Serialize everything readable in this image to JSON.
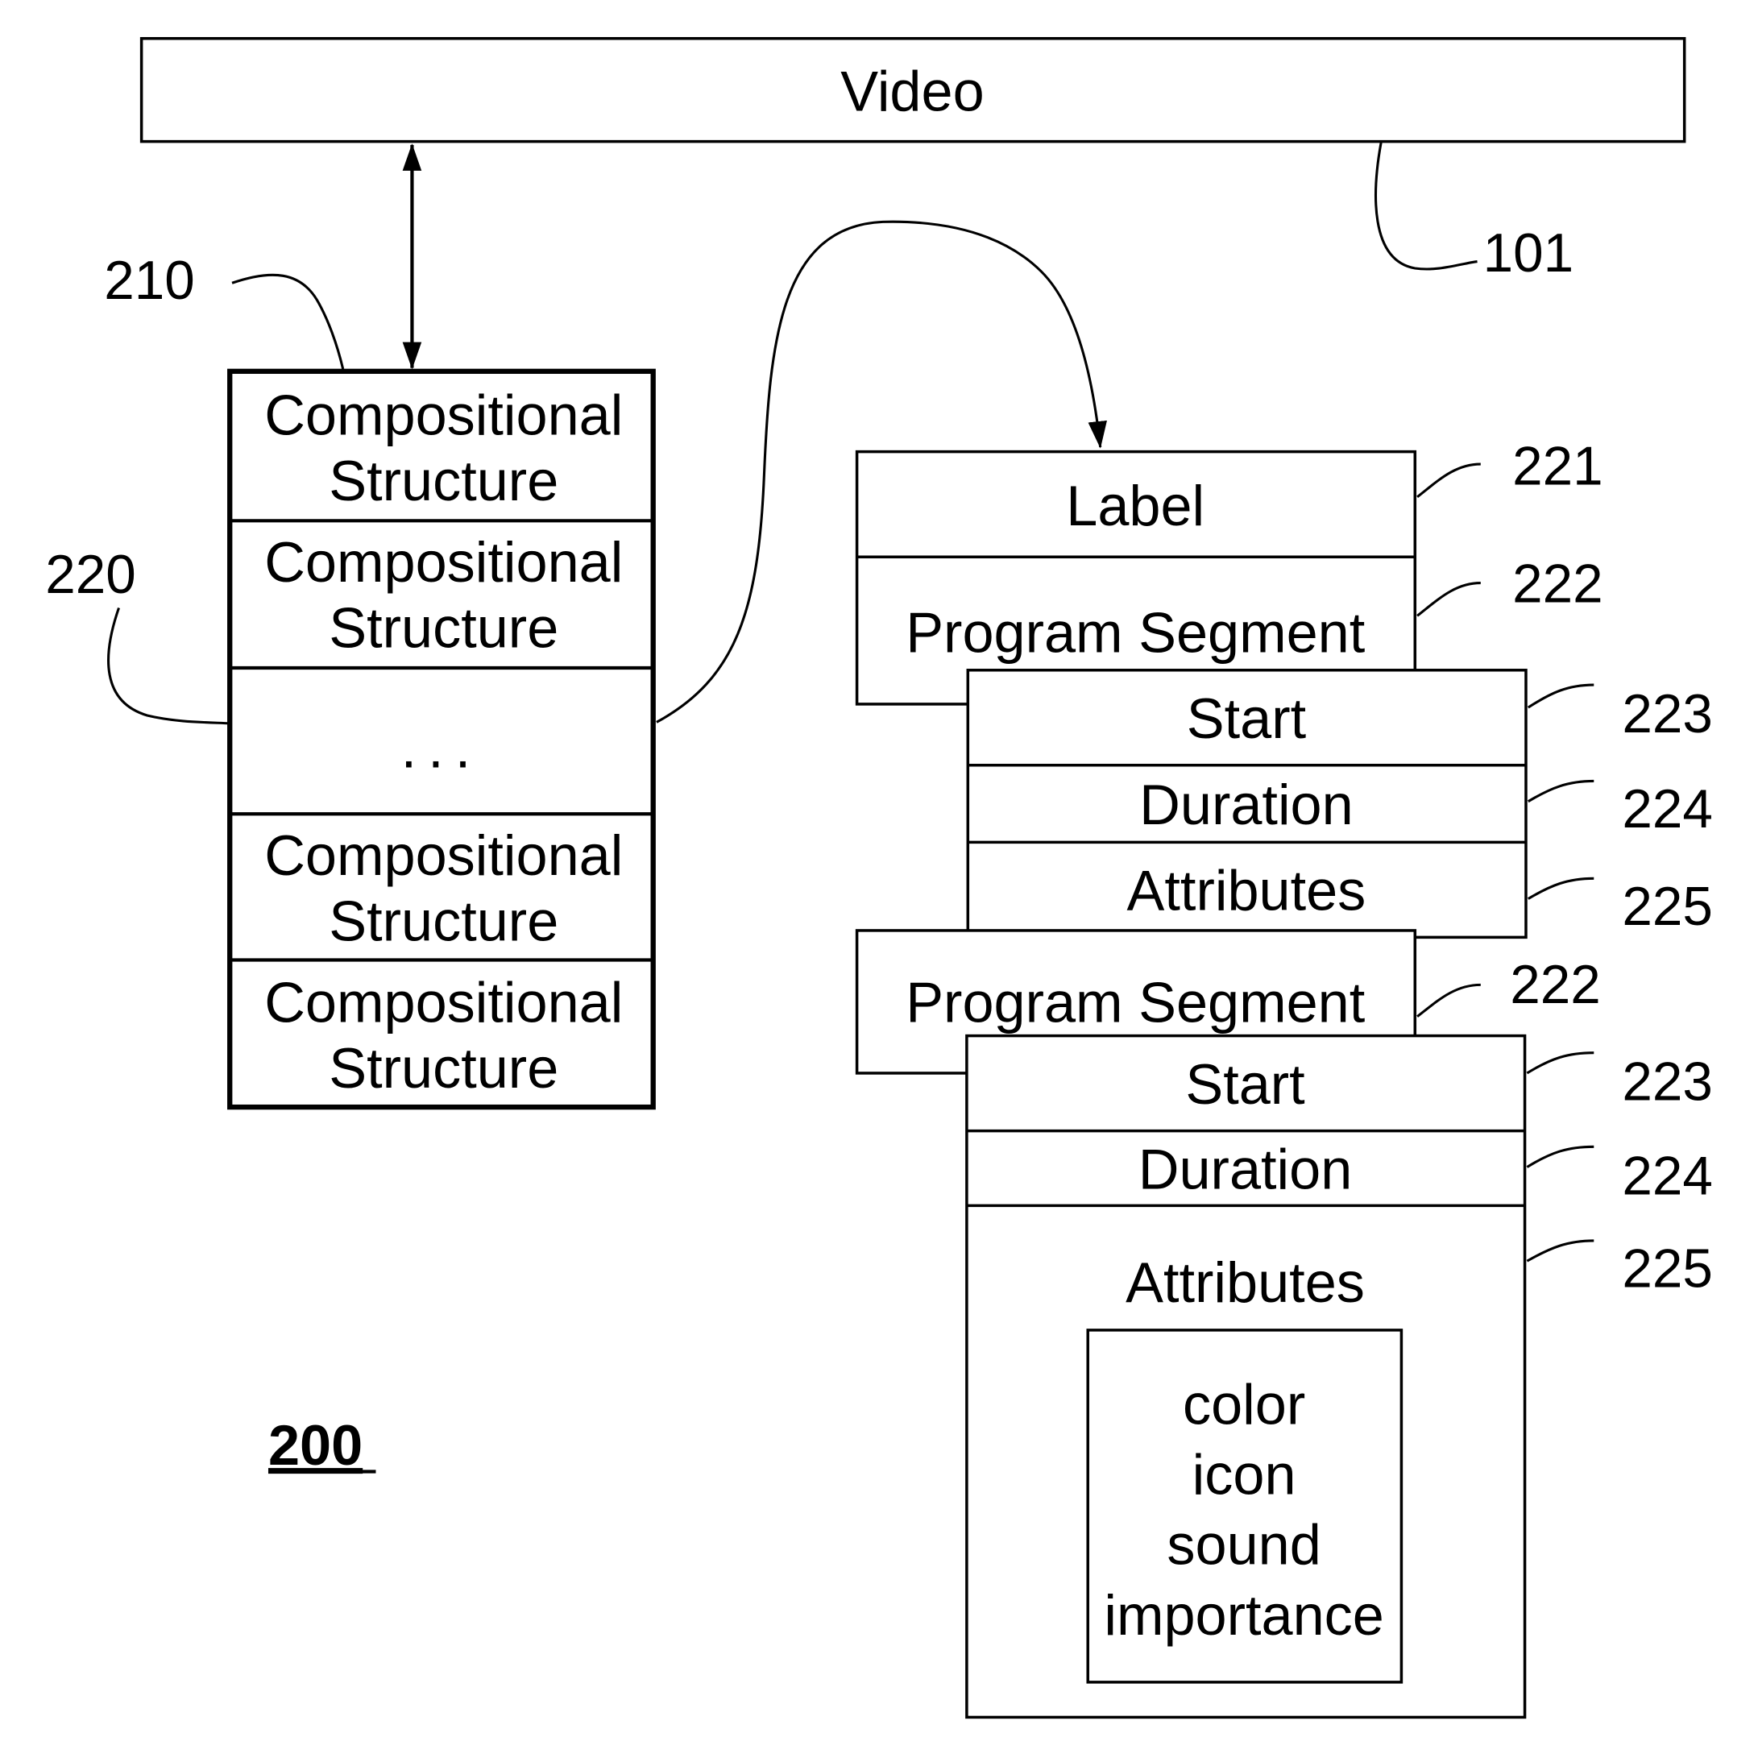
{
  "video": {
    "label": "Video",
    "ref": "101"
  },
  "left_stack": {
    "ref_outer": "210",
    "ref_inner": "220",
    "cells": [
      {
        "line1": "Compositional",
        "line2": "Structure"
      },
      {
        "line1": "Compositional",
        "line2": "Structure"
      },
      {
        "ellipsis": "..."
      },
      {
        "line1": "Compositional",
        "line2": "Structure"
      },
      {
        "line1": "Compositional",
        "line2": "Structure"
      }
    ]
  },
  "right": {
    "label": {
      "text": "Label",
      "ref": "221"
    },
    "segments": [
      {
        "title": "Program Segment",
        "ref": "222",
        "start": {
          "text": "Start",
          "ref": "223"
        },
        "duration": {
          "text": "Duration",
          "ref": "224"
        },
        "attributes": {
          "text": "Attributes",
          "ref": "225"
        }
      },
      {
        "title": "Program Segment",
        "ref": "222",
        "start": {
          "text": "Start",
          "ref": "223"
        },
        "duration": {
          "text": "Duration",
          "ref": "224"
        },
        "attributes": {
          "text": "Attributes",
          "ref": "225",
          "items": [
            "color",
            "icon",
            "sound",
            "importance"
          ]
        }
      }
    ]
  },
  "figure_number": "200"
}
